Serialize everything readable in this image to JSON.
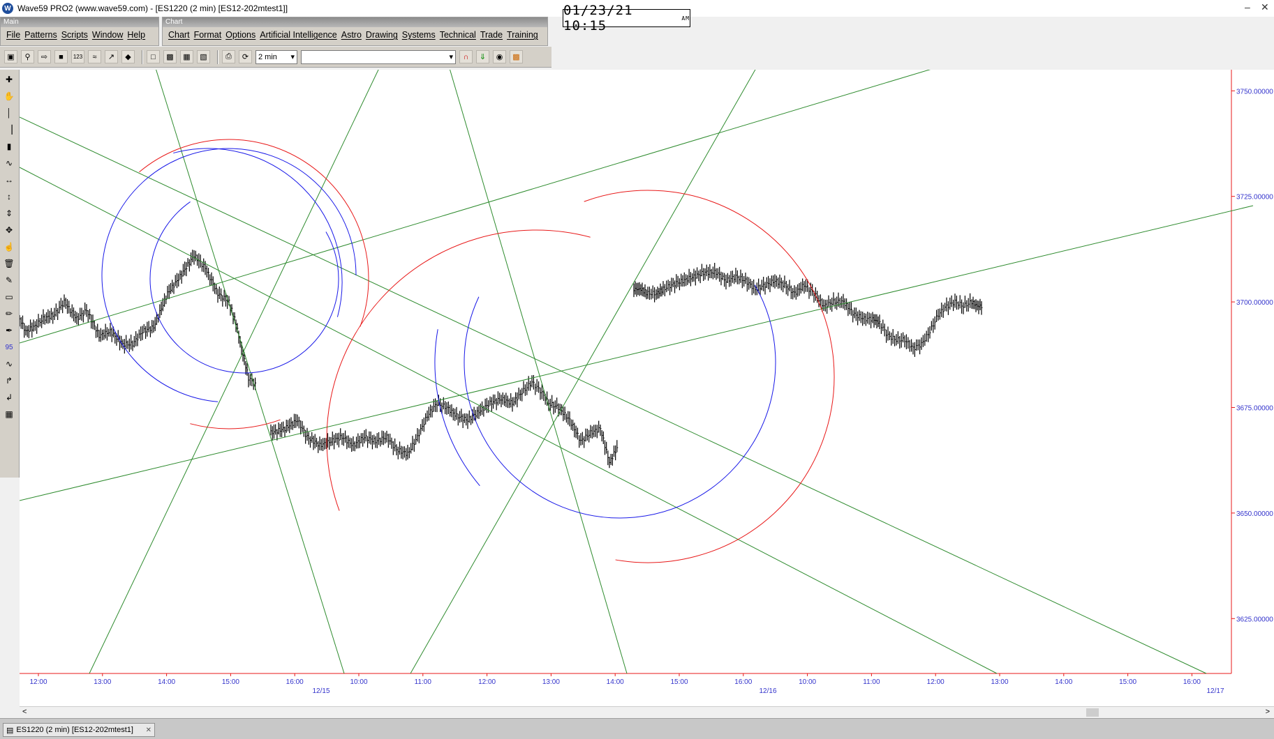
{
  "window": {
    "title": "Wave59 PRO2 (www.wave59.com) - [ES1220 (2 min) [ES12-202mtest1]]",
    "clock": "01/23/21 10:15",
    "clock_ampm": "AM"
  },
  "main_band": {
    "label": "Main",
    "menu": [
      "File",
      "Patterns",
      "Scripts",
      "Window",
      "Help"
    ]
  },
  "chart_band": {
    "label": "Chart",
    "menu": [
      "Chart",
      "Format",
      "Options",
      "Artificial Intelligence",
      "Astro",
      "Drawing",
      "Systems",
      "Technical",
      "Trade",
      "Training"
    ]
  },
  "toolbar": {
    "interval": "2 min",
    "symbol_select": ""
  },
  "left_tools": [
    "crosshair-icon",
    "hand-icon",
    "vertical-line-icon",
    "bar-chart-icon",
    "candle-icon",
    "line-chart-icon",
    "ruler-h-icon",
    "ruler-v-icon",
    "arrow-v-icon",
    "arrow-cross-icon",
    "pointer-icon",
    "trash-icon",
    "pencil-icon",
    "eraser-icon",
    "brush-icon",
    "pen-icon",
    "wave-count-95-icon",
    "sine-icon",
    "pitch-1-icon",
    "pitch-2-icon",
    "grid-icon"
  ],
  "chart_data": {
    "type": "line",
    "ylim": [
      3612,
      3755
    ],
    "y_ticks": [
      "3750.00000",
      "3725.00000",
      "3700.00000",
      "3675.00000",
      "3650.00000",
      "3625.00000"
    ],
    "y_tick_values": [
      3750,
      3725,
      3700,
      3675,
      3650,
      3625
    ],
    "x_ticks": [
      "12:00",
      "13:00",
      "14:00",
      "15:00",
      "16:00",
      "10:00",
      "11:00",
      "12:00",
      "13:00",
      "14:00",
      "15:00",
      "16:00",
      "10:00",
      "11:00",
      "12:00",
      "13:00",
      "14:00",
      "15:00",
      "16:00"
    ],
    "date_labels": [
      "12/15",
      "12/16",
      "12/17"
    ],
    "series": [
      {
        "color": "#000000",
        "segments": [
          [
            [
              3696,
              0
            ],
            [
              3693,
              9
            ],
            [
              3694,
              20
            ],
            [
              3696,
              34
            ],
            [
              3697,
              50
            ],
            [
              3700,
              64
            ],
            [
              3696,
              82
            ],
            [
              3698,
              96
            ],
            [
              3692,
              114
            ],
            [
              3693,
              130
            ],
            [
              3690,
              148
            ],
            [
              3690,
              162
            ],
            [
              3693,
              176
            ],
            [
              3694,
              192
            ],
            [
              3702,
              212
            ],
            [
              3706,
              230
            ],
            [
              3711,
              250
            ],
            [
              3708,
              266
            ],
            [
              3702,
              284
            ],
            [
              3700,
              300
            ],
            [
              3695,
              310
            ],
            [
              3689,
              318
            ],
            [
              3682,
              328
            ],
            [
              3680,
              340
            ]
          ],
          [
            [
              3669,
              360
            ],
            [
              3670,
              380
            ],
            [
              3672,
              398
            ],
            [
              3668,
              412
            ],
            [
              3666,
              430
            ],
            [
              3667,
              446
            ],
            [
              3668,
              462
            ],
            [
              3666,
              478
            ],
            [
              3668,
              494
            ],
            [
              3667,
              510
            ],
            [
              3668,
              526
            ],
            [
              3665,
              540
            ],
            [
              3664,
              556
            ],
            [
              3668,
              570
            ],
            [
              3673,
              584
            ],
            [
              3676,
              598
            ],
            [
              3675,
              612
            ],
            [
              3673,
              626
            ],
            [
              3672,
              642
            ],
            [
              3674,
              658
            ],
            [
              3676,
              674
            ],
            [
              3677,
              690
            ],
            [
              3676,
              706
            ],
            [
              3679,
              722
            ],
            [
              3681,
              734
            ],
            [
              3679,
              746
            ],
            [
              3676,
              758
            ],
            [
              3675,
              772
            ],
            [
              3672,
              788
            ],
            [
              3667,
              804
            ],
            [
              3669,
              818
            ],
            [
              3670,
              832
            ],
            [
              3662,
              845
            ],
            [
              3666,
              858
            ]
          ],
          [
            [
              3703,
              880
            ],
            [
              3703,
              890
            ],
            [
              3702,
              900
            ],
            [
              3702,
              912
            ],
            [
              3703,
              922
            ],
            [
              3704,
              934
            ],
            [
              3705,
              950
            ],
            [
              3706,
              966
            ],
            [
              3707,
              982
            ],
            [
              3707,
              998
            ],
            [
              3705,
              1012
            ],
            [
              3706,
              1026
            ],
            [
              3705,
              1040
            ],
            [
              3703,
              1054
            ],
            [
              3704,
              1068
            ],
            [
              3705,
              1082
            ],
            [
              3704,
              1096
            ],
            [
              3702,
              1110
            ],
            [
              3704,
              1124
            ],
            [
              3702,
              1138
            ],
            [
              3699,
              1152
            ],
            [
              3700,
              1166
            ],
            [
              3700,
              1180
            ],
            [
              3697,
              1196
            ],
            [
              3696,
              1210
            ],
            [
              3696,
              1222
            ],
            [
              3695,
              1232
            ],
            [
              3692,
              1244
            ],
            [
              3691,
              1256
            ],
            [
              3691,
              1268
            ],
            [
              3689,
              1280
            ],
            [
              3690,
              1292
            ],
            [
              3693,
              1304
            ],
            [
              3697,
              1316
            ],
            [
              3699,
              1328
            ],
            [
              3700,
              1340
            ],
            [
              3699,
              1352
            ],
            [
              3700,
              1364
            ],
            [
              3699,
              1372
            ],
            [
              3699,
              1380
            ]
          ]
        ]
      }
    ],
    "drawing_colors": {
      "lines": "#2e8b2e",
      "red_arcs": "#e81818",
      "blue_arcs": "#1818e8"
    }
  },
  "status": {
    "tab_label": "ES1220 (2 min) [ES12-202mtest1]"
  }
}
